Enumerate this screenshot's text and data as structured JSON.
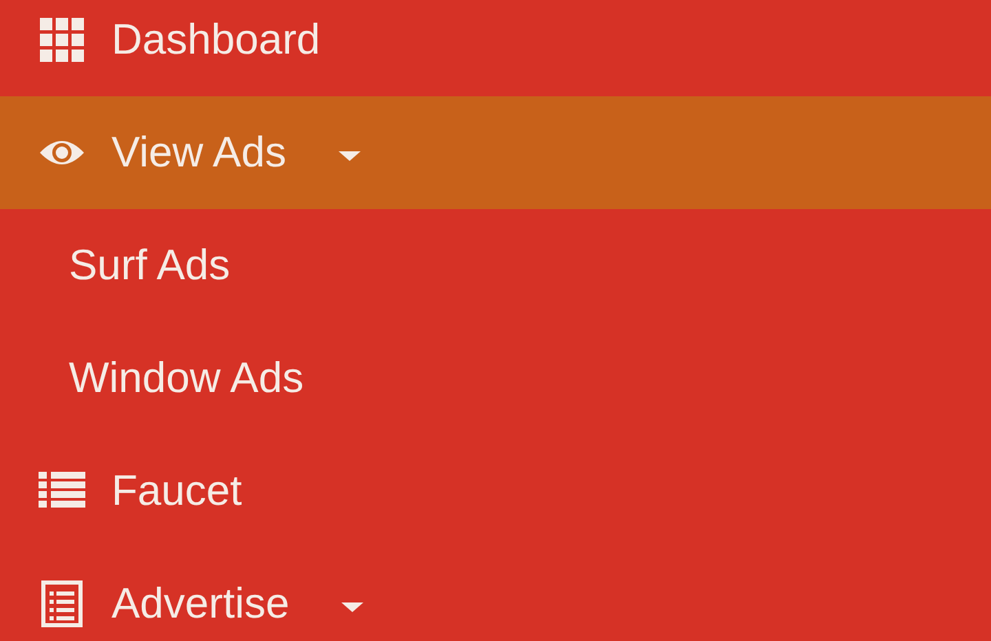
{
  "sidebar": {
    "items": [
      {
        "label": "Dashboard",
        "selected": false,
        "expandable": false
      },
      {
        "label": "View Ads",
        "selected": true,
        "expandable": true,
        "children": [
          {
            "label": "Surf Ads"
          },
          {
            "label": "Window Ads"
          }
        ]
      },
      {
        "label": "Faucet",
        "selected": false,
        "expandable": false
      },
      {
        "label": "Advertise",
        "selected": false,
        "expandable": true
      }
    ]
  }
}
